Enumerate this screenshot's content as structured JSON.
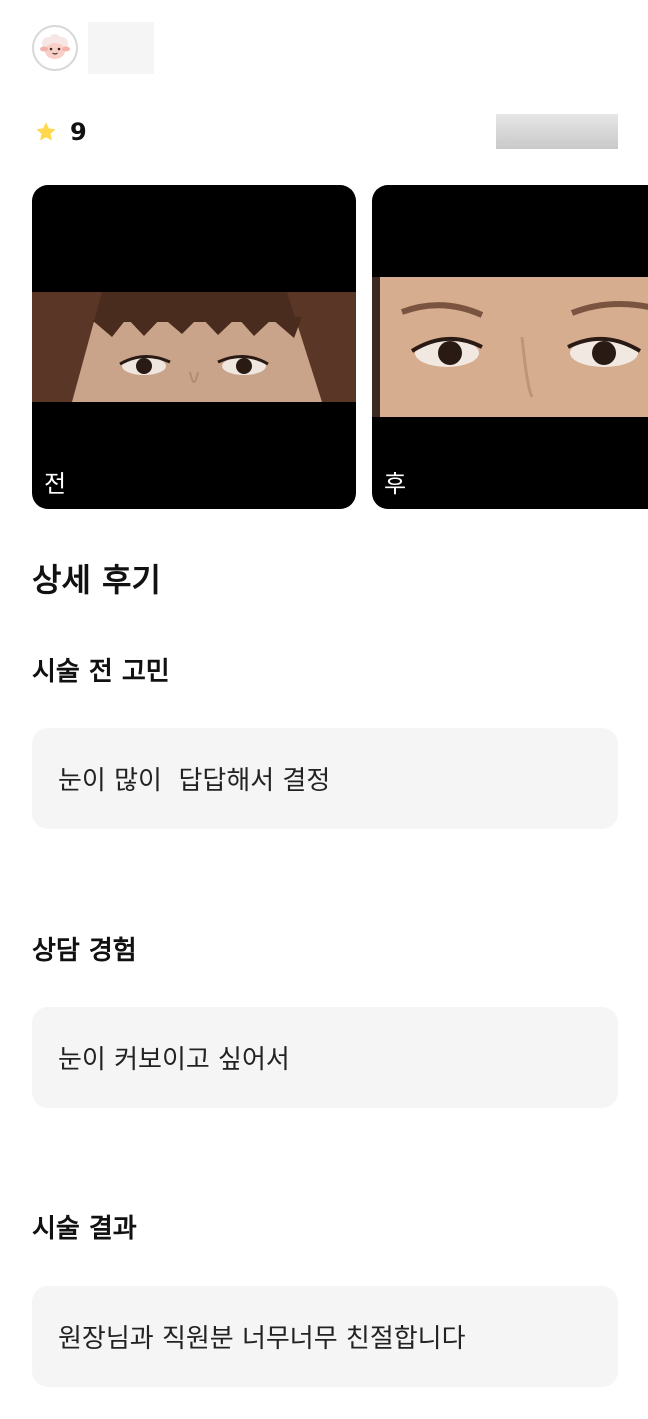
{
  "rating": {
    "value": "9",
    "icon": "star-icon",
    "star_color": "#ffd84d"
  },
  "photos": [
    {
      "label": "전"
    },
    {
      "label": "후"
    }
  ],
  "review": {
    "heading": "상세 후기",
    "sections": [
      {
        "title": "시술 전 고민",
        "answer": "눈이 많이  답답해서 결정"
      },
      {
        "title": "상담 경험",
        "answer": "눈이 커보이고 싶어서"
      },
      {
        "title": "시술 결과",
        "answer": "원장님과 직원분 너무너무 친절합니다"
      }
    ]
  }
}
